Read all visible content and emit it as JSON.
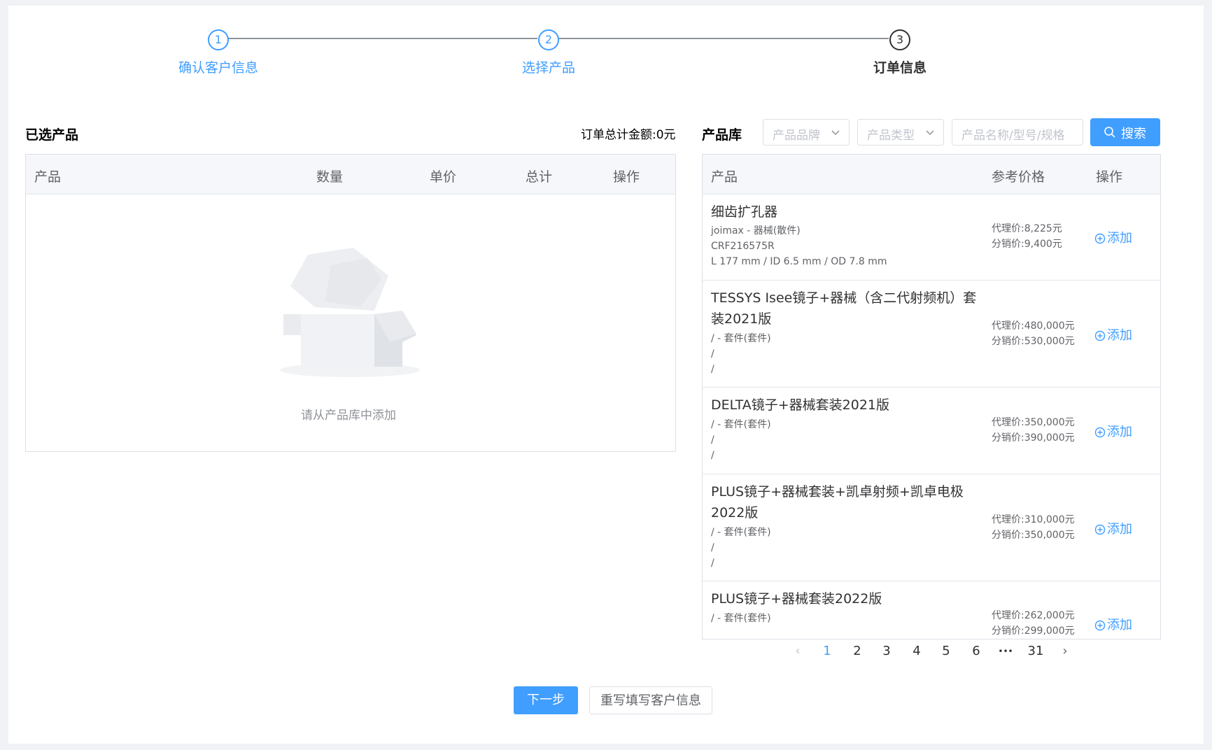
{
  "steps": [
    {
      "number": "1",
      "label": "确认客户信息"
    },
    {
      "number": "2",
      "label": "选择产品"
    },
    {
      "number": "3",
      "label": "订单信息"
    }
  ],
  "selected": {
    "title": "已选产品",
    "total_amount": "订单总计金额:0元",
    "columns": [
      "产品",
      "数量",
      "单价",
      "总计",
      "操作"
    ],
    "empty_text": "请从产品库中添加"
  },
  "library": {
    "title": "产品库",
    "brand_placeholder": "产品品牌",
    "type_placeholder": "产品类型",
    "search_placeholder": "产品名称/型号/规格",
    "search_button": "搜索",
    "columns": [
      "产品",
      "参考价格",
      "操作"
    ],
    "add_label": "添加",
    "products": [
      {
        "name": "细齿扩孔器",
        "lines": [
          "joimax - 器械(散件)",
          "CRF216575R",
          "L 177 mm / ID 6.5 mm / OD 7.8 mm"
        ],
        "agent_price": "代理价:8,225元",
        "dist_price": "分销价:9,400元"
      },
      {
        "name": "TESSYS Isee镜子+器械（含二代射频机）套装2021版",
        "lines": [
          "/ - 套件(套件)",
          "/",
          "/"
        ],
        "agent_price": "代理价:480,000元",
        "dist_price": "分销价:530,000元"
      },
      {
        "name": "DELTA镜子+器械套装2021版",
        "lines": [
          "/ - 套件(套件)",
          "/",
          "/"
        ],
        "agent_price": "代理价:350,000元",
        "dist_price": "分销价:390,000元"
      },
      {
        "name": "PLUS镜子+器械套装+凯卓射频+凯卓电极2022版",
        "lines": [
          "/ - 套件(套件)",
          "/",
          "/"
        ],
        "agent_price": "代理价:310,000元",
        "dist_price": "分销价:350,000元"
      },
      {
        "name": "PLUS镜子+器械套装2022版",
        "lines": [
          "/ - 套件(套件)"
        ],
        "agent_price": "代理价:262,000元",
        "dist_price": "分销价:299,000元"
      }
    ]
  },
  "pagination": {
    "prev": "‹",
    "pages": [
      "1",
      "2",
      "3",
      "4",
      "5",
      "6"
    ],
    "ellipsis": "•••",
    "last": "31",
    "next": "›",
    "current": "1"
  },
  "actions": {
    "next_label": "下一步",
    "rewrite_label": "重写填写客户信息"
  },
  "colors": {
    "primary": "#409eff",
    "text": "#303133",
    "border": "#dcdfe6"
  }
}
